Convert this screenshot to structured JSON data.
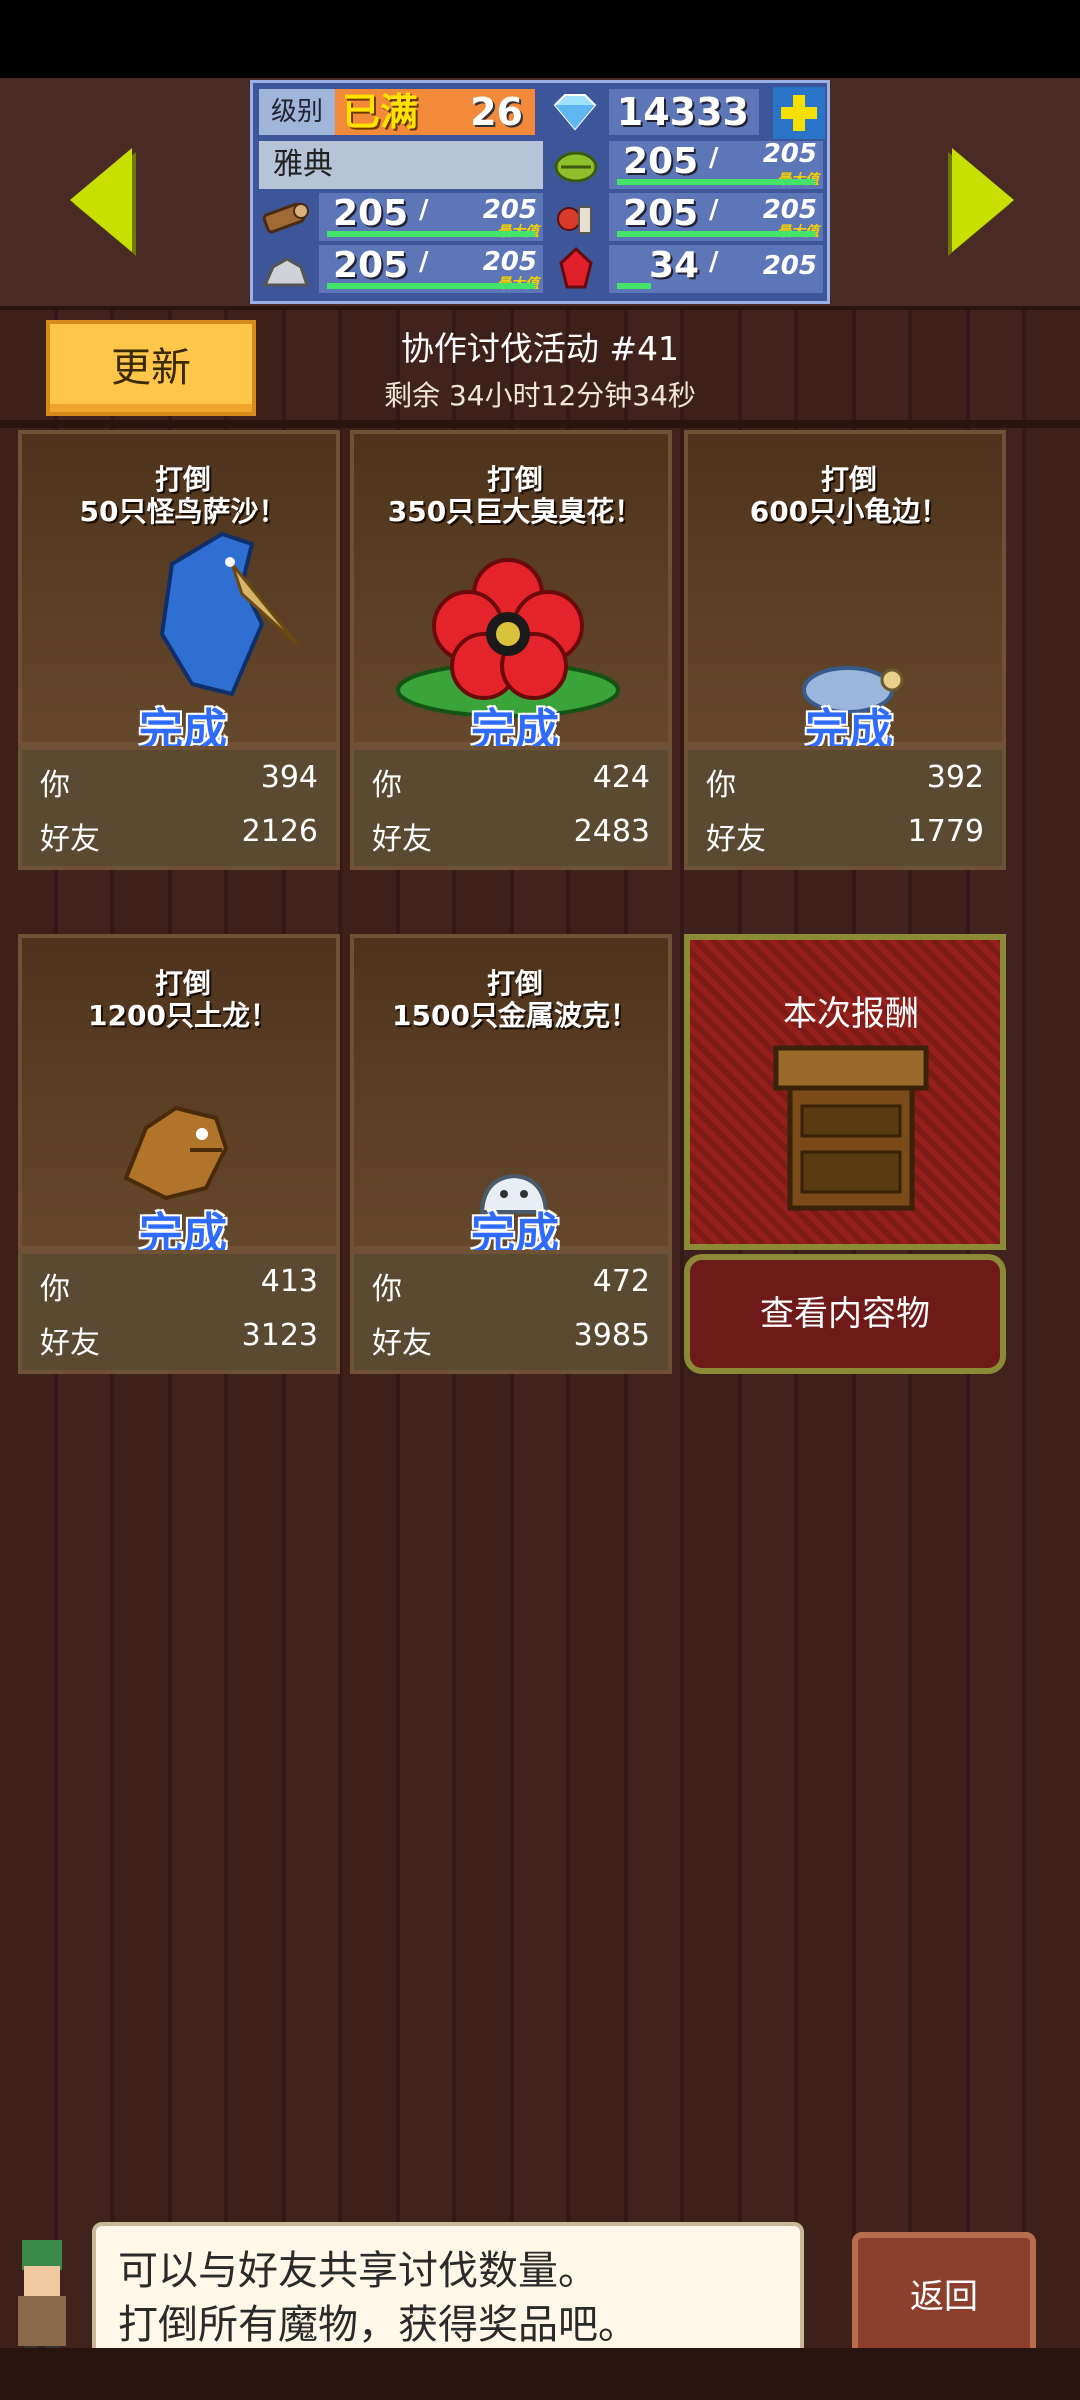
{
  "player": {
    "level_label": "级别",
    "level_status": "已满",
    "level": "26",
    "gems": "14333",
    "city": "雅典"
  },
  "resources": [
    {
      "icon": "wood-icon",
      "value": "205",
      "max": "205",
      "max_label": "最大值",
      "fill": 1.0
    },
    {
      "icon": "herb-icon",
      "value": "205",
      "max": "205",
      "max_label": "最大值",
      "fill": 1.0
    },
    {
      "icon": "food-icon",
      "value": "205",
      "max": "205",
      "max_label": "最大值",
      "fill": 1.0
    },
    {
      "icon": "ore-icon",
      "value": "205",
      "max": "205",
      "max_label": "最大值",
      "fill": 1.0
    },
    {
      "icon": "ruby-icon",
      "value": "34",
      "max": "205",
      "max_label": "",
      "fill": 0.17
    }
  ],
  "header": {
    "refresh_label": "更新",
    "event_title": "协作讨伐活动 #41",
    "event_timer": "剩余 34小时12分钟34秒"
  },
  "tasks": [
    {
      "line1": "打倒",
      "line2": "50只怪鸟萨沙！",
      "status": "完成",
      "you_label": "你",
      "you": "394",
      "friends_label": "好友",
      "friends": "2126",
      "monster": "bird-monster-icon"
    },
    {
      "line1": "打倒",
      "line2": "350只巨大臭臭花！",
      "status": "完成",
      "you_label": "你",
      "you": "424",
      "friends_label": "好友",
      "friends": "2483",
      "monster": "flower-monster-icon"
    },
    {
      "line1": "打倒",
      "line2": "600只小龟边！",
      "status": "完成",
      "you_label": "你",
      "you": "392",
      "friends_label": "好友",
      "friends": "1779",
      "monster": "turtle-monster-icon"
    },
    {
      "line1": "打倒",
      "line2": "1200只土龙！",
      "status": "完成",
      "you_label": "你",
      "you": "413",
      "friends_label": "好友",
      "friends": "3123",
      "monster": "dragon-monster-icon"
    },
    {
      "line1": "打倒",
      "line2": "1500只金属波克！",
      "status": "完成",
      "you_label": "你",
      "you": "472",
      "friends_label": "好友",
      "friends": "3985",
      "monster": "metal-slime-icon"
    }
  ],
  "reward": {
    "title": "本次报酬",
    "button": "查看内容物"
  },
  "dialog": {
    "line1": "可以与好友共享讨伐数量。",
    "line2": "打倒所有魔物，获得奖品吧。"
  },
  "back_label": "返回",
  "colors": {
    "accent_arrow": "#c8e000",
    "done_text": "#2f6bff",
    "refresh_button": "#ffc64a",
    "stats_panel": "#3d5599"
  }
}
